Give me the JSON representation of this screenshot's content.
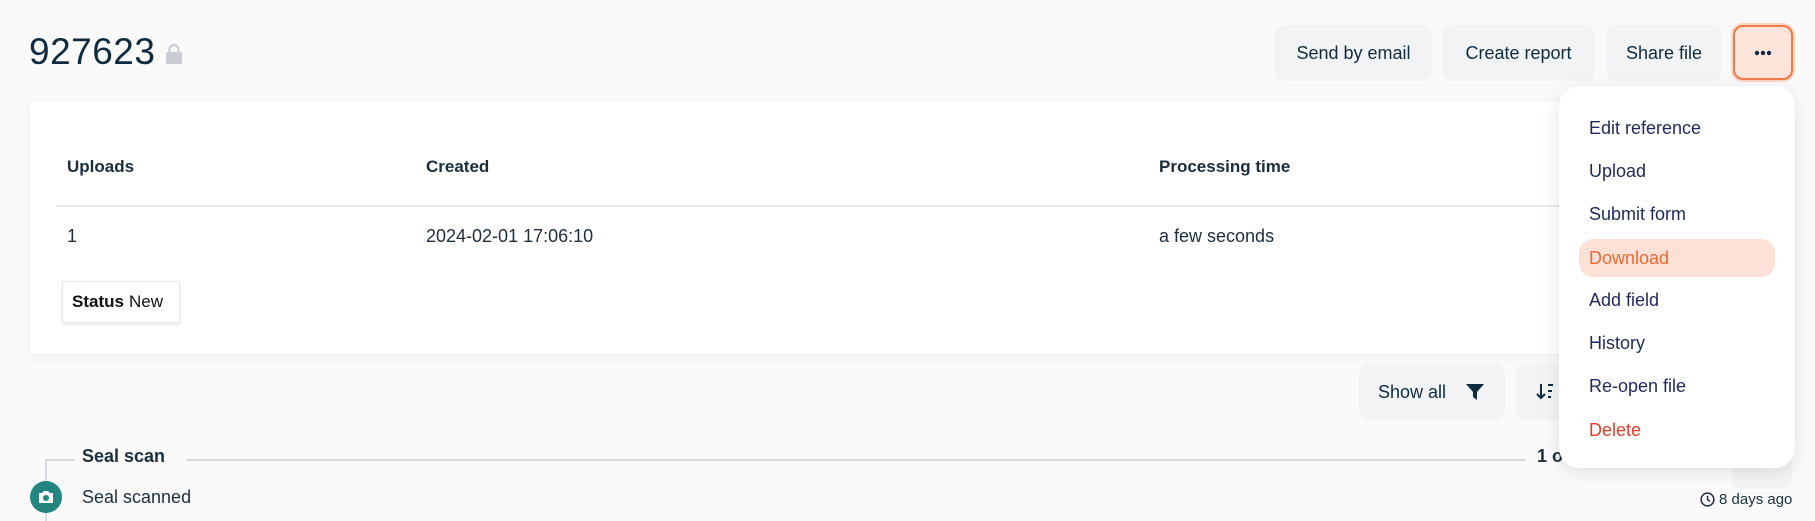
{
  "header": {
    "title": "927623",
    "actions": {
      "send_email": "Send by email",
      "create_report": "Create report",
      "share_file": "Share file",
      "more": "•••"
    }
  },
  "summary": {
    "columns": [
      "Uploads",
      "Created",
      "Processing time"
    ],
    "values": [
      "1",
      "2024-02-01 17:06:10",
      "a few seconds"
    ],
    "status_label": "Status",
    "status_value": "New"
  },
  "filters": {
    "show_all": "Show all"
  },
  "timeline": {
    "section_title": "Seal scan",
    "section_count": "1 o",
    "event_label": "Seal scanned",
    "event_time": "8 days ago"
  },
  "menu": {
    "items": [
      "Edit reference",
      "Upload",
      "Submit form",
      "Download",
      "Add field",
      "History",
      "Re-open file",
      "Delete"
    ],
    "active_index": 3
  },
  "colors": {
    "accent": "#ea6a35",
    "danger": "#e33b2a",
    "teal": "#22857e"
  }
}
